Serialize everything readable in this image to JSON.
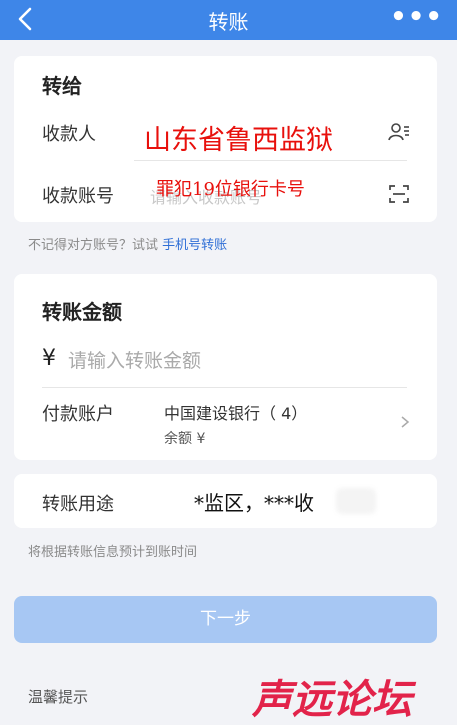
{
  "header": {
    "title": "转账"
  },
  "recipient_section": {
    "title": "转给",
    "payee_label": "收款人",
    "account_label": "收款账号",
    "account_placeholder": "请输入收款账号",
    "overlay_payee": "山东省鲁西监狱",
    "overlay_account": "罪犯19位银行卡号"
  },
  "hint": {
    "text": "不记得对方账号？试试",
    "link": "手机号转账"
  },
  "amount_section": {
    "title": "转账金额",
    "currency_symbol": "¥",
    "amount_placeholder": "请输入转账金额",
    "pay_account_label": "付款账户",
    "bank_name": "中国建设银行（      4）",
    "balance_label": "余额 ¥"
  },
  "purpose_section": {
    "label": "转账用途",
    "value": "*监区，***收"
  },
  "arrival_hint": "将根据转账信息预计到账时间",
  "next_button": "下一步",
  "tips_label": "温馨提示",
  "watermark": "声远论坛",
  "colors": {
    "header_bg": "#3e86e8",
    "overlay_red": "#e8100c",
    "link_blue": "#2f6fd6",
    "button_disabled": "#a7c7f3",
    "watermark_red": "#e2234a"
  }
}
